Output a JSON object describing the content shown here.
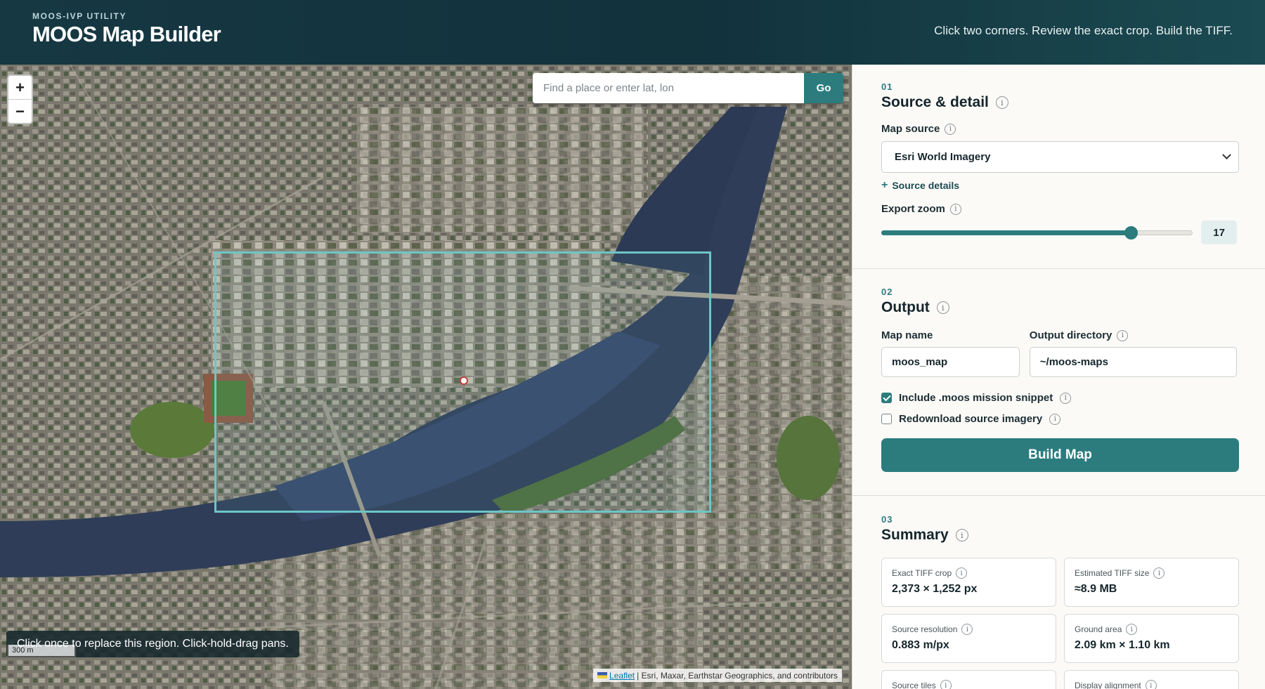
{
  "header": {
    "eyebrow": "MOOS-IVP UTILITY",
    "title": "MOOS Map Builder",
    "tagline": "Click two corners. Review the exact crop. Build the TIFF."
  },
  "map": {
    "zoom_in": "+",
    "zoom_out": "−",
    "search_placeholder": "Find a place or enter lat, lon",
    "search_value": "",
    "go_label": "Go",
    "hint": "Click once to replace this region. Click-hold-drag pans.",
    "scale": "300 m",
    "attribution_link": "Leaflet",
    "attribution_text": "| Esri, Maxar, Earthstar Geographics, and contributors"
  },
  "source": {
    "number": "01",
    "title": "Source & detail",
    "map_source_label": "Map source",
    "map_source_value": "Esri World Imagery",
    "details_label": "Source details",
    "zoom_label": "Export zoom",
    "zoom_value": "17",
    "zoom_fraction": 0.8
  },
  "output": {
    "number": "02",
    "title": "Output",
    "map_name_label": "Map name",
    "map_name_value": "moos_map",
    "output_dir_label": "Output directory",
    "output_dir_value": "~/moos-maps",
    "include_snippet_label": "Include .moos mission snippet",
    "include_snippet_checked": true,
    "redownload_label": "Redownload source imagery",
    "redownload_checked": false,
    "build_label": "Build Map"
  },
  "summary": {
    "number": "03",
    "title": "Summary",
    "cards": [
      {
        "label": "Exact TIFF crop",
        "value": "2,373 × 1,252 px"
      },
      {
        "label": "Estimated TIFF size",
        "value": "≈8.9 MB"
      },
      {
        "label": "Source resolution",
        "value": "0.883 m/px"
      },
      {
        "label": "Ground area",
        "value": "2.09 km × 1.10 km"
      },
      {
        "label": "Source tiles",
        "value": ""
      },
      {
        "label": "Display alignment",
        "value": ""
      }
    ]
  },
  "colors": {
    "accent": "#2c7c7e",
    "header_bg": "#163842",
    "selection": "#6cc6c6",
    "river": "#2c3a55"
  },
  "icons": {
    "info": "info-icon",
    "chevron": "chevron-down-icon",
    "plus": "plus-icon",
    "marker": "center-marker-icon"
  }
}
